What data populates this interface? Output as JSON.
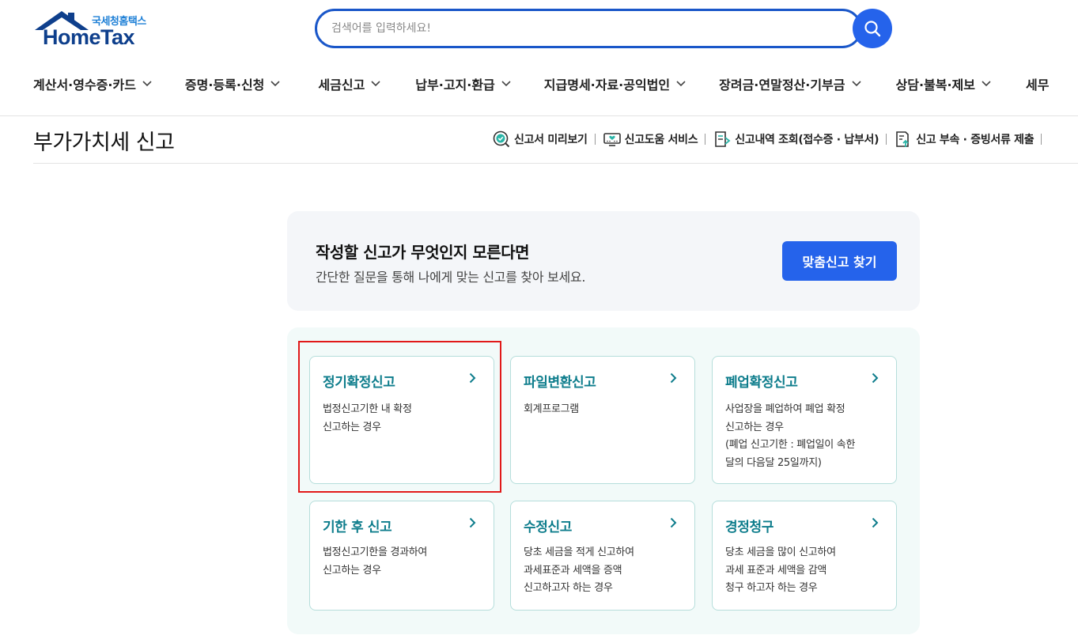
{
  "logo": {
    "sub": "국세청홈택스",
    "main": "HomeTax"
  },
  "search": {
    "placeholder": "검색어를 입력하세요!"
  },
  "nav": {
    "items": [
      "계산서·영수증·카드",
      "증명·등록·신청",
      "세금신고",
      "납부·고지·환급",
      "지급명세·자료·공익법인",
      "장려금·연말정산·기부금",
      "상담·불복·제보",
      "세무"
    ]
  },
  "page": {
    "title": "부가가치세 신고"
  },
  "tools": [
    {
      "label": "신고서 미리보기",
      "icon": "preview-check-icon"
    },
    {
      "label": "신고도움 서비스",
      "icon": "help-monitor-icon"
    },
    {
      "label": "신고내역 조회(접수증 · 납부서)",
      "icon": "history-document-icon"
    },
    {
      "label": "신고 부속 · 증빙서류 제출",
      "icon": "upload-document-icon"
    }
  ],
  "banner": {
    "title": "작성할 신고가 무엇인지 모른다면",
    "desc": "간단한 질문을 통해 나에게 맞는 신고를 찾아 보세요.",
    "button": "맞춤신고 찾기"
  },
  "cards": [
    {
      "title": "정기확정신고",
      "desc": "법정신고기한 내 확정\n신고하는 경우"
    },
    {
      "title": "파일변환신고",
      "desc": "회계프로그램"
    },
    {
      "title": "폐업확정신고",
      "desc": "사업장을 폐업하여 폐업 확정\n신고하는 경우\n(폐업 신고기한 : 폐업일이 속한\n달의 다음달 25일까지)"
    },
    {
      "title": "기한 후 신고",
      "desc": "법정신고기한을 경과하여\n신고하는 경우"
    },
    {
      "title": "수정신고",
      "desc": "당초 세금을 적게 신고하여\n과세표준과 세액을 증액\n신고하고자 하는 경우"
    },
    {
      "title": "경정청구",
      "desc": "당초 세금을 많이 신고하여\n과세 표준과 세액을 감액\n청구 하고자 하는 경우"
    }
  ],
  "colors": {
    "primary": "#2563eb",
    "card_title": "#0e7d8c",
    "highlight": "#e11919"
  }
}
